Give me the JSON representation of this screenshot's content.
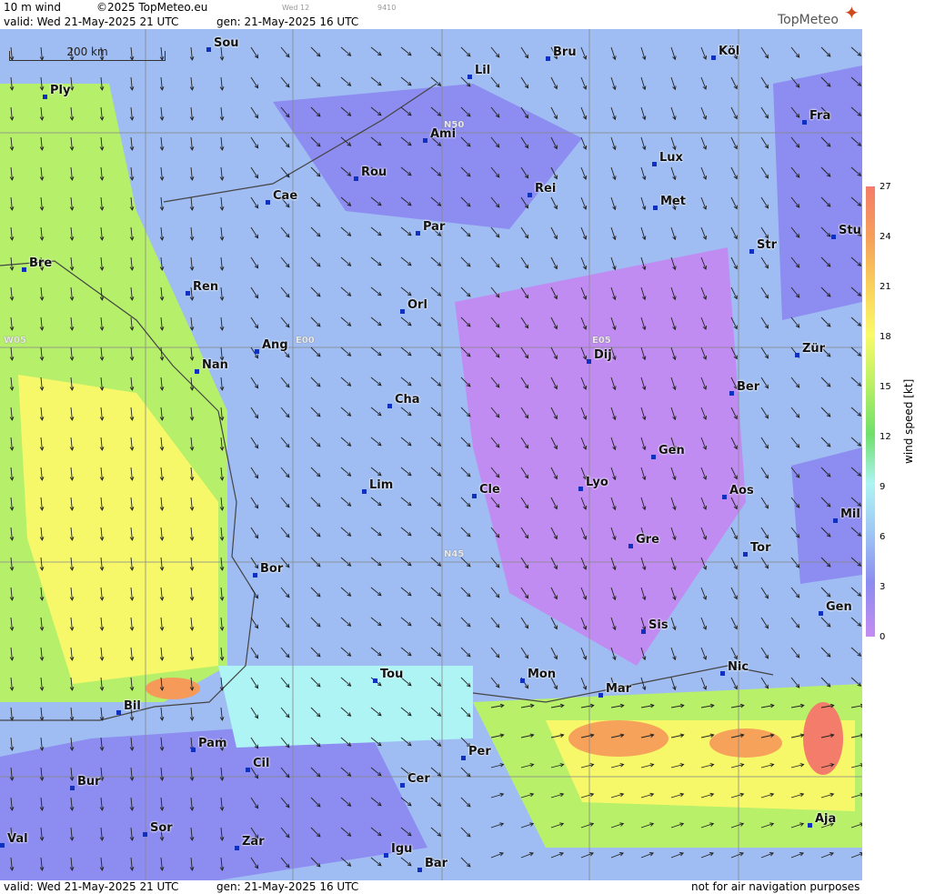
{
  "header": {
    "product": "10 m wind",
    "copyright": "©2025 TopMeteo.eu",
    "run_small": "Wed 12",
    "code_small": "9410",
    "valid": "valid:  Wed  21-May-2025  21 UTC",
    "gen": "gen: 21-May-2025 16 UTC",
    "logo": "TopMeteo"
  },
  "footer": {
    "valid": "valid:  Wed  21-May-2025  21 UTC",
    "gen": "gen: 21-May-2025 16 UTC",
    "disclaimer": "not for air navigation purposes"
  },
  "scale_bar": "200 km",
  "grid_labels": [
    "N50",
    "W05",
    "E00",
    "E05",
    "N45"
  ],
  "cities": [
    "Sou",
    "Ply",
    "Lil",
    "Bru",
    "Köl",
    "Ami",
    "Fra",
    "Lux",
    "Rou",
    "Cae",
    "Rei",
    "Met",
    "Par",
    "Stu",
    "Str",
    "Bre",
    "Ren",
    "Orl",
    "Ang",
    "Dij",
    "Zür",
    "Nan",
    "Ber",
    "Cha",
    "Gen",
    "Lim",
    "Cle",
    "Lyo",
    "Aos",
    "Mil",
    "Tor",
    "Gre",
    "Bor",
    "Gen",
    "Sis",
    "Nic",
    "Tou",
    "Mon",
    "Mar",
    "Bil",
    "Pam",
    "Cil",
    "Per",
    "Cer",
    "Bur",
    "Aja",
    "Sor",
    "Val",
    "Zar",
    "Igu",
    "Bar"
  ],
  "legend": {
    "title": "wind speed [kt]",
    "ticks": [
      "27",
      "24",
      "21",
      "18",
      "15",
      "12",
      "9",
      "6",
      "3",
      "0"
    ],
    "colors": [
      "#f47c6a",
      "#f6a25a",
      "#fafa6a",
      "#b9f065",
      "#6fe06a",
      "#aef4f4",
      "#9ec6f4",
      "#8c8cf0",
      "#c48cf2"
    ]
  }
}
